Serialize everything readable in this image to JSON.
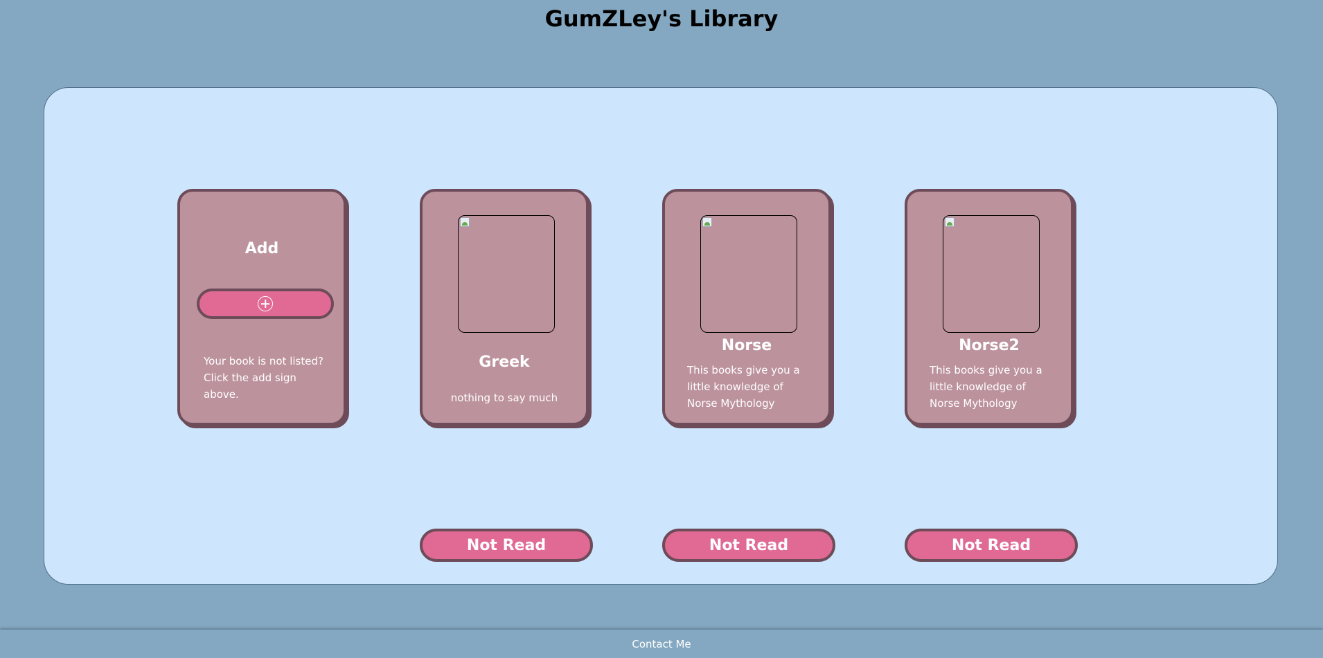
{
  "header": {
    "title": "GumZLey's Library"
  },
  "add_card": {
    "title": "Add",
    "icon": "plus-circle-icon",
    "hint_line1": "Your book is not listed?",
    "hint_line2": "Click the add sign above."
  },
  "books": [
    {
      "title": "Greek",
      "description": "nothing to say much",
      "status": "Not Read"
    },
    {
      "title": "Norse",
      "description": "This books give you a little knowledge of Norse Mythology",
      "status": "Not Read"
    },
    {
      "title": "Norse2",
      "description": "This books give you a little knowledge of Norse Mythology",
      "status": "Not Read"
    }
  ],
  "footer": {
    "contact_label": "Contact Me"
  },
  "colors": {
    "background": "#84a8c1",
    "panel": "#cde6fd",
    "card": "#bc929d",
    "card_border": "#6d4b59",
    "button": "#e06a93"
  }
}
